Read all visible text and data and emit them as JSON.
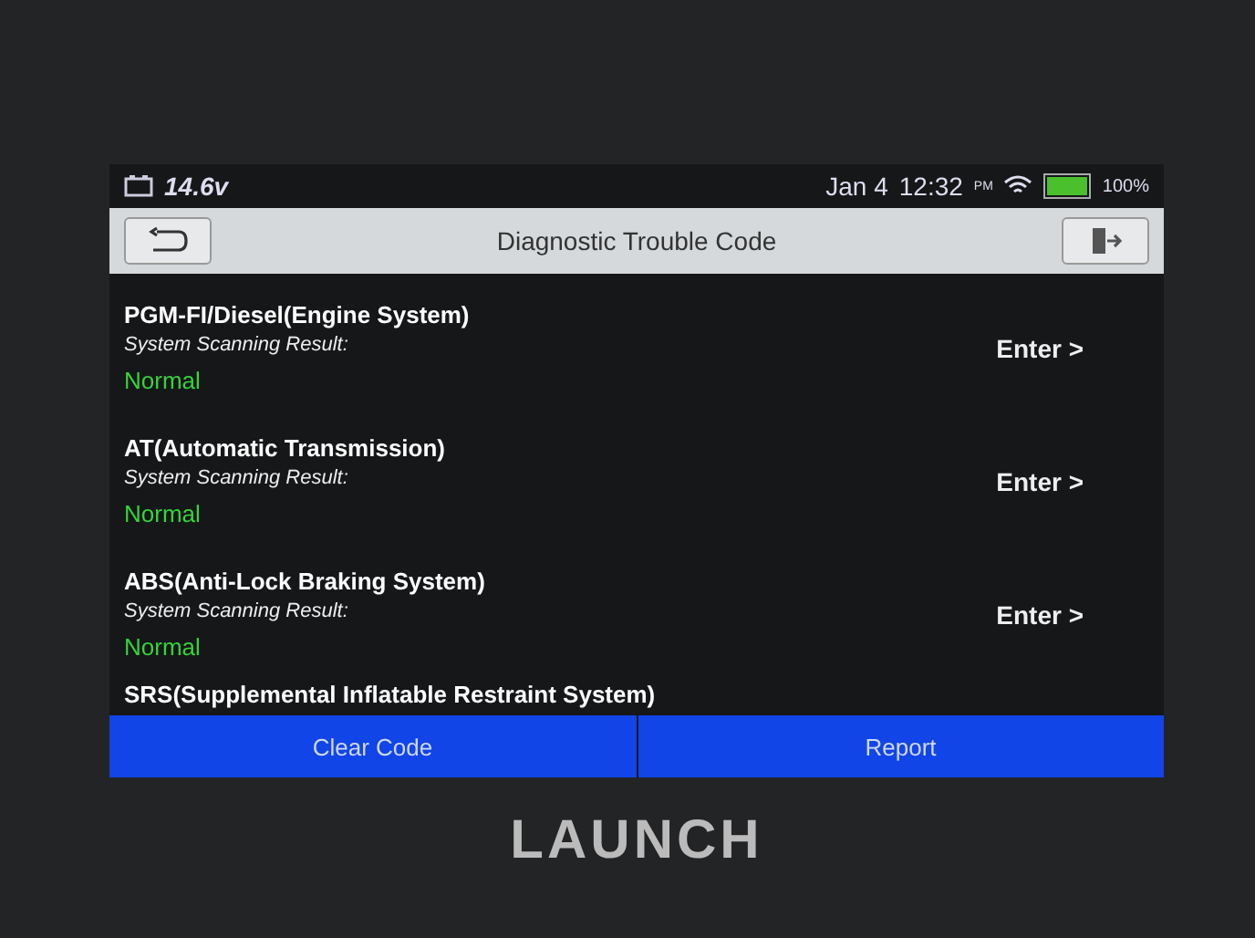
{
  "status_bar": {
    "voltage": "14.6v",
    "date": "Jan 4",
    "time": "12:32",
    "ampm": "PM",
    "battery": "100%"
  },
  "header": {
    "title": "Diagnostic Trouble Code"
  },
  "systems": [
    {
      "name": "PGM-FI/Diesel(Engine System)",
      "result_label": "System Scanning Result:",
      "result": "Normal",
      "action": "Enter >"
    },
    {
      "name": "AT(Automatic Transmission)",
      "result_label": "System Scanning Result:",
      "result": "Normal",
      "action": "Enter >"
    },
    {
      "name": "ABS(Anti-Lock Braking System)",
      "result_label": "System Scanning Result:",
      "result": "Normal",
      "action": "Enter >"
    },
    {
      "name": "SRS(Supplemental Inflatable Restraint System)"
    }
  ],
  "buttons": [
    "Clear Code",
    "Report"
  ],
  "brand": "LAUNCH"
}
